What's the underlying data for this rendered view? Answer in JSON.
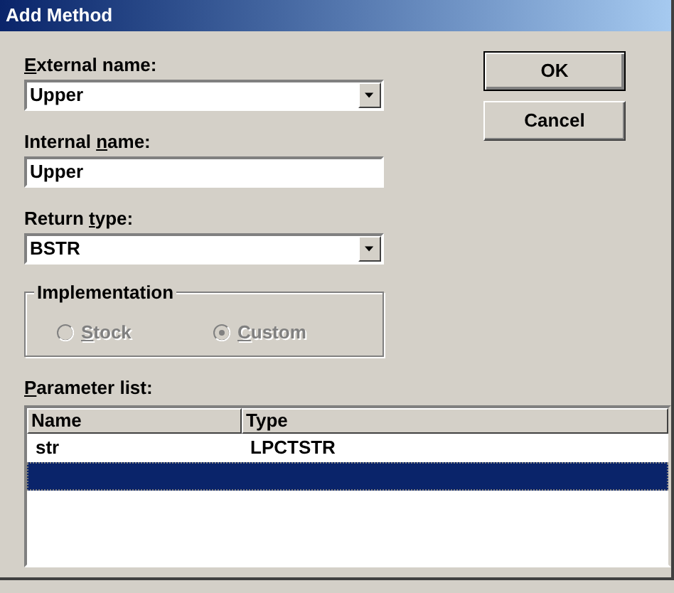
{
  "window": {
    "title": "Add Method"
  },
  "external_name": {
    "label": {
      "key": "E",
      "post": "xternal name:"
    },
    "value": "Upper"
  },
  "internal_name": {
    "label": {
      "pre": "Internal ",
      "key": "n",
      "post": "ame:"
    },
    "value": "Upper"
  },
  "return_type": {
    "label": {
      "pre": "Return ",
      "key": "t",
      "post": "ype:"
    },
    "value": "BSTR"
  },
  "implementation": {
    "title": "Implementation",
    "options": [
      {
        "label": {
          "key": "S",
          "post": "tock"
        },
        "selected": false,
        "disabled": true
      },
      {
        "label": {
          "key": "C",
          "post": "ustom"
        },
        "selected": true,
        "disabled": true
      }
    ]
  },
  "parameter_list": {
    "label": {
      "key": "P",
      "post": "arameter list:"
    },
    "columns": [
      "Name",
      "Type"
    ],
    "rows": [
      {
        "cells": [
          "str",
          "LPCTSTR"
        ],
        "selected": false
      },
      {
        "selected": true
      }
    ]
  },
  "buttons": [
    {
      "label": "OK",
      "default": true
    },
    {
      "label": "Cancel",
      "default": false
    }
  ]
}
